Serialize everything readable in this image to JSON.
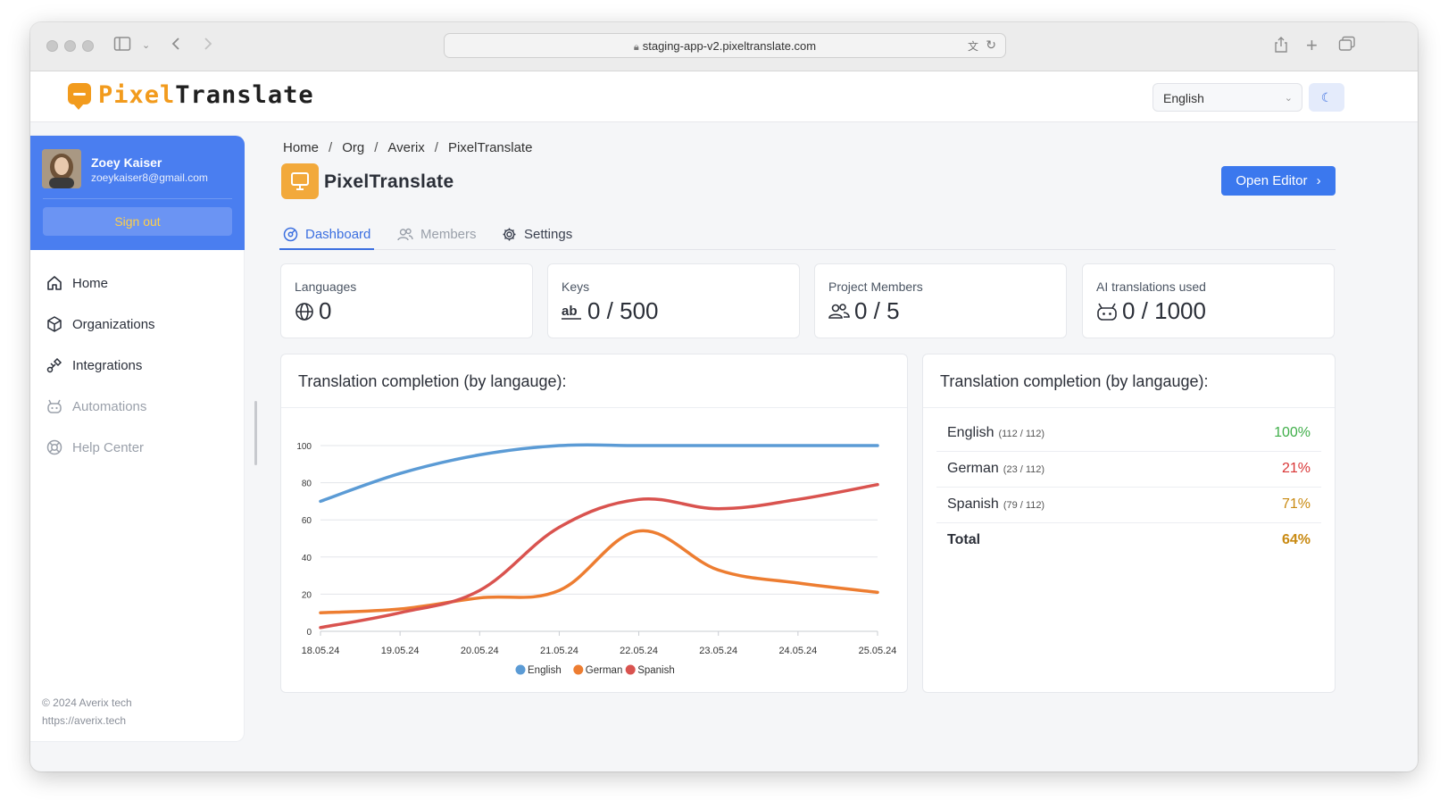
{
  "browser": {
    "url": "staging-app-v2.pixeltranslate.com"
  },
  "header": {
    "logo_part1": "Pixel",
    "logo_part2": "Translate",
    "language_select": "English"
  },
  "sidebar": {
    "user": {
      "name": "Zoey Kaiser",
      "email": "zoeykaiser8@gmail.com"
    },
    "sign_out": "Sign out",
    "items": [
      {
        "label": "Home",
        "icon": "home-icon",
        "enabled": true
      },
      {
        "label": "Organizations",
        "icon": "box-icon",
        "enabled": true
      },
      {
        "label": "Integrations",
        "icon": "plug-icon",
        "enabled": true
      },
      {
        "label": "Automations",
        "icon": "robot-icon",
        "enabled": false
      },
      {
        "label": "Help Center",
        "icon": "lifebuoy-icon",
        "enabled": false
      }
    ],
    "footer_copyright": "© 2024 Averix tech",
    "footer_url": "https://averix.tech"
  },
  "breadcrumb": [
    "Home",
    "Org",
    "Averix",
    "PixelTranslate"
  ],
  "project": {
    "title": "PixelTranslate",
    "open_editor": "Open Editor"
  },
  "tabs": [
    {
      "label": "Dashboard",
      "active": true
    },
    {
      "label": "Members",
      "active": false
    },
    {
      "label": "Settings",
      "active": false
    }
  ],
  "stats": [
    {
      "label": "Languages",
      "value": "0",
      "icon": "globe-icon"
    },
    {
      "label": "Keys",
      "value": "0 / 500",
      "icon": "ab-text-icon"
    },
    {
      "label": "Project Members",
      "value": "0 / 5",
      "icon": "users-icon"
    },
    {
      "label": "AI translations used",
      "value": "0 / 1000",
      "icon": "robot-icon"
    }
  ],
  "chart_panel_title": "Translation completion (by langauge):",
  "table_panel_title": "Translation completion (by langauge):",
  "completion_table": [
    {
      "language": "English",
      "counts": "(112 / 112)",
      "percent": "100%",
      "color": "#3fae49"
    },
    {
      "language": "German",
      "counts": "(23 / 112)",
      "percent": "21%",
      "color": "#d93636"
    },
    {
      "language": "Spanish",
      "counts": "(79 / 112)",
      "percent": "71%",
      "color": "#c98a12"
    }
  ],
  "completion_total": {
    "label": "Total",
    "percent": "64%",
    "color": "#c98a12"
  },
  "chart_data": {
    "type": "line",
    "title": "Translation completion (by langauge):",
    "x": [
      "18.05.24",
      "19.05.24",
      "20.05.24",
      "21.05.24",
      "22.05.24",
      "23.05.24",
      "24.05.24",
      "25.05.24"
    ],
    "ylim": [
      0,
      100
    ],
    "yticks": [
      0,
      20,
      40,
      60,
      80,
      100
    ],
    "grid": true,
    "legend": "bottom",
    "series": [
      {
        "name": "English",
        "color": "#5b9bd5",
        "values": [
          70,
          85,
          95,
          100,
          100,
          100,
          100,
          100
        ]
      },
      {
        "name": "German",
        "color": "#ed7d31",
        "values": [
          10,
          12,
          18,
          22,
          54,
          33,
          26,
          21
        ]
      },
      {
        "name": "Spanish",
        "color": "#d9534f",
        "values": [
          2,
          10,
          22,
          56,
          71,
          66,
          71,
          79
        ]
      }
    ]
  }
}
